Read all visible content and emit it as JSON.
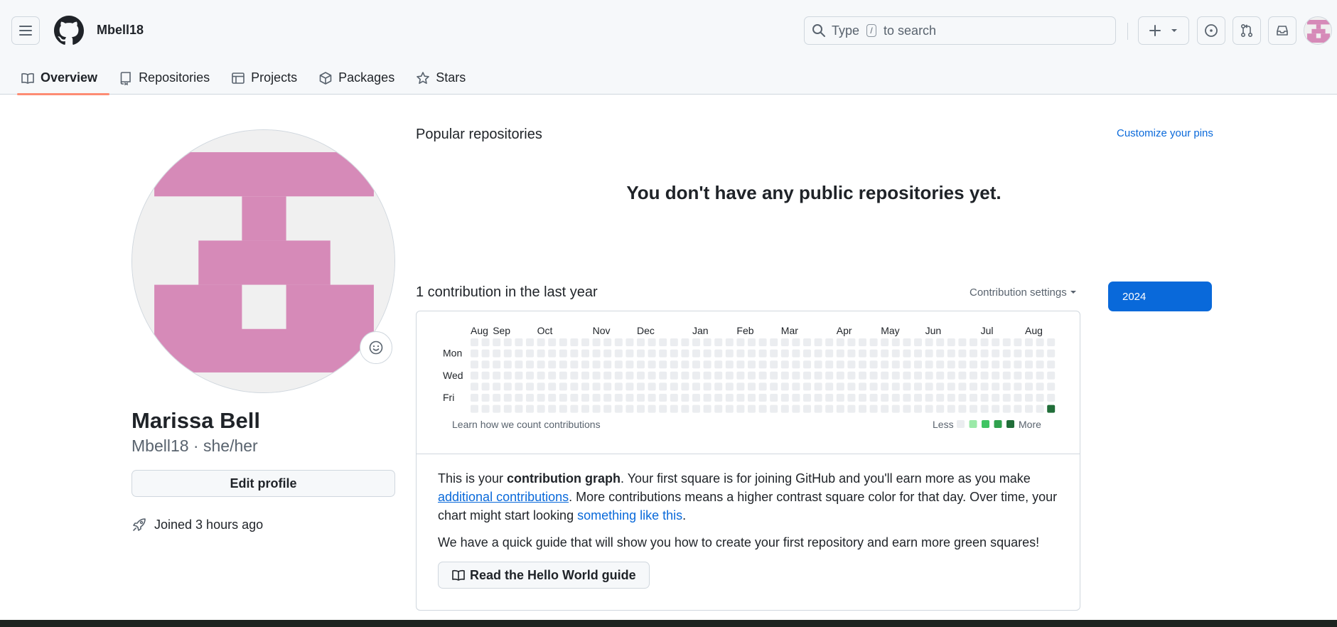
{
  "header": {
    "username": "Mbell18",
    "search_prefix": "Type",
    "search_key": "/",
    "search_suffix": "to search"
  },
  "tabs": [
    {
      "label": "Overview",
      "icon": "book-icon",
      "active": true
    },
    {
      "label": "Repositories",
      "icon": "repo-icon",
      "active": false
    },
    {
      "label": "Projects",
      "icon": "table-icon",
      "active": false
    },
    {
      "label": "Packages",
      "icon": "package-icon",
      "active": false
    },
    {
      "label": "Stars",
      "icon": "star-icon",
      "active": false
    }
  ],
  "profile": {
    "full_name": "Marissa Bell",
    "login_pronoun": "Mbell18 · she/her",
    "edit_label": "Edit profile",
    "joined": "Joined 3 hours ago",
    "avatar_color": "#d68ab8"
  },
  "popular": {
    "title": "Popular repositories",
    "customize": "Customize your pins",
    "empty": "You don't have any public repositories yet."
  },
  "contributions": {
    "title": "1 contribution in the last year",
    "settings": "Contribution settings",
    "year": "2024",
    "months": [
      "Aug",
      "Sep",
      "Oct",
      "Nov",
      "Dec",
      "Jan",
      "Feb",
      "Mar",
      "Apr",
      "May",
      "Jun",
      "Jul",
      "Aug"
    ],
    "days": [
      "Mon",
      "Wed",
      "Fri"
    ],
    "weeks": 53,
    "learn": "Learn how we count contributions",
    "less": "Less",
    "more": "More",
    "empty_color": "#ebedf0",
    "level_colors": [
      "#ebedf0",
      "#9be9a8",
      "#40c463",
      "#30a14e",
      "#216e39"
    ],
    "filled_cell": {
      "week": 52,
      "day": 6,
      "level": 4
    }
  },
  "info": {
    "p1_a": "This is your ",
    "p1_b": "contribution graph",
    "p1_c": ". Your first square is for joining GitHub and you'll earn more as you make ",
    "p1_link1": "additional contributions",
    "p1_d": ". More contributions means a higher contrast square color for that day. Over time, your chart might start looking ",
    "p1_link2": "something like this",
    "p1_e": ".",
    "p2": "We have a quick guide that will show you how to create your first repository and earn more green squares!",
    "guide_button": "Read the Hello World guide"
  }
}
